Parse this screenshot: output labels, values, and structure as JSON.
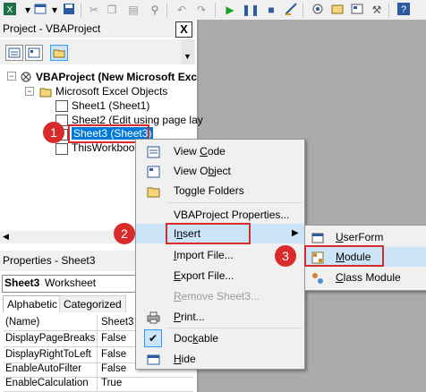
{
  "project_pane": {
    "title": "Project - VBAProject",
    "close": "X",
    "tree": [
      {
        "label": "VBAProject (New Microsoft Exc"
      },
      {
        "label": "Microsoft Excel Objects"
      },
      {
        "label": "Sheet1 (Sheet1)"
      },
      {
        "label": "Sheet2 (Edit using page lay"
      },
      {
        "label": "Sheet3 (Sheet3)"
      },
      {
        "label": "ThisWorkbook"
      }
    ]
  },
  "properties_pane": {
    "title": "Properties - Sheet3",
    "close": "X",
    "object_name": "Sheet3",
    "object_type": "Worksheet",
    "tabs": [
      "Alphabetic",
      "Categorized"
    ],
    "rows": [
      {
        "name": "(Name)",
        "value": "Sheet3"
      },
      {
        "name": "DisplayPageBreaks",
        "value": "False"
      },
      {
        "name": "DisplayRightToLeft",
        "value": "False"
      },
      {
        "name": "EnableAutoFilter",
        "value": "False"
      },
      {
        "name": "EnableCalculation",
        "value": "True"
      }
    ]
  },
  "context_menu": {
    "items": [
      {
        "label": "View Code",
        "u": "C"
      },
      {
        "label": "View Object",
        "u": "b"
      },
      {
        "label": "Toggle Folders",
        "u": ""
      },
      {
        "label": "VBAProject Properties...",
        "u": ""
      },
      {
        "label": "Insert",
        "u": "n"
      },
      {
        "label": "Import File...",
        "u": "I"
      },
      {
        "label": "Export File...",
        "u": "E"
      },
      {
        "label": "Remove Sheet3...",
        "u": "R"
      },
      {
        "label": "Print...",
        "u": "P"
      },
      {
        "label": "Dockable",
        "u": "k"
      },
      {
        "label": "Hide",
        "u": "H"
      }
    ]
  },
  "submenu": {
    "items": [
      {
        "label": "UserForm"
      },
      {
        "label": "Module"
      },
      {
        "label": "Class Module"
      }
    ]
  },
  "step_badges": [
    "1",
    "2",
    "3"
  ],
  "colors": {
    "accent_red": "#d92b2b",
    "selection_blue": "#0078d7",
    "menu_highlight": "#cce4f7",
    "workspace_gray": "#ababab"
  }
}
